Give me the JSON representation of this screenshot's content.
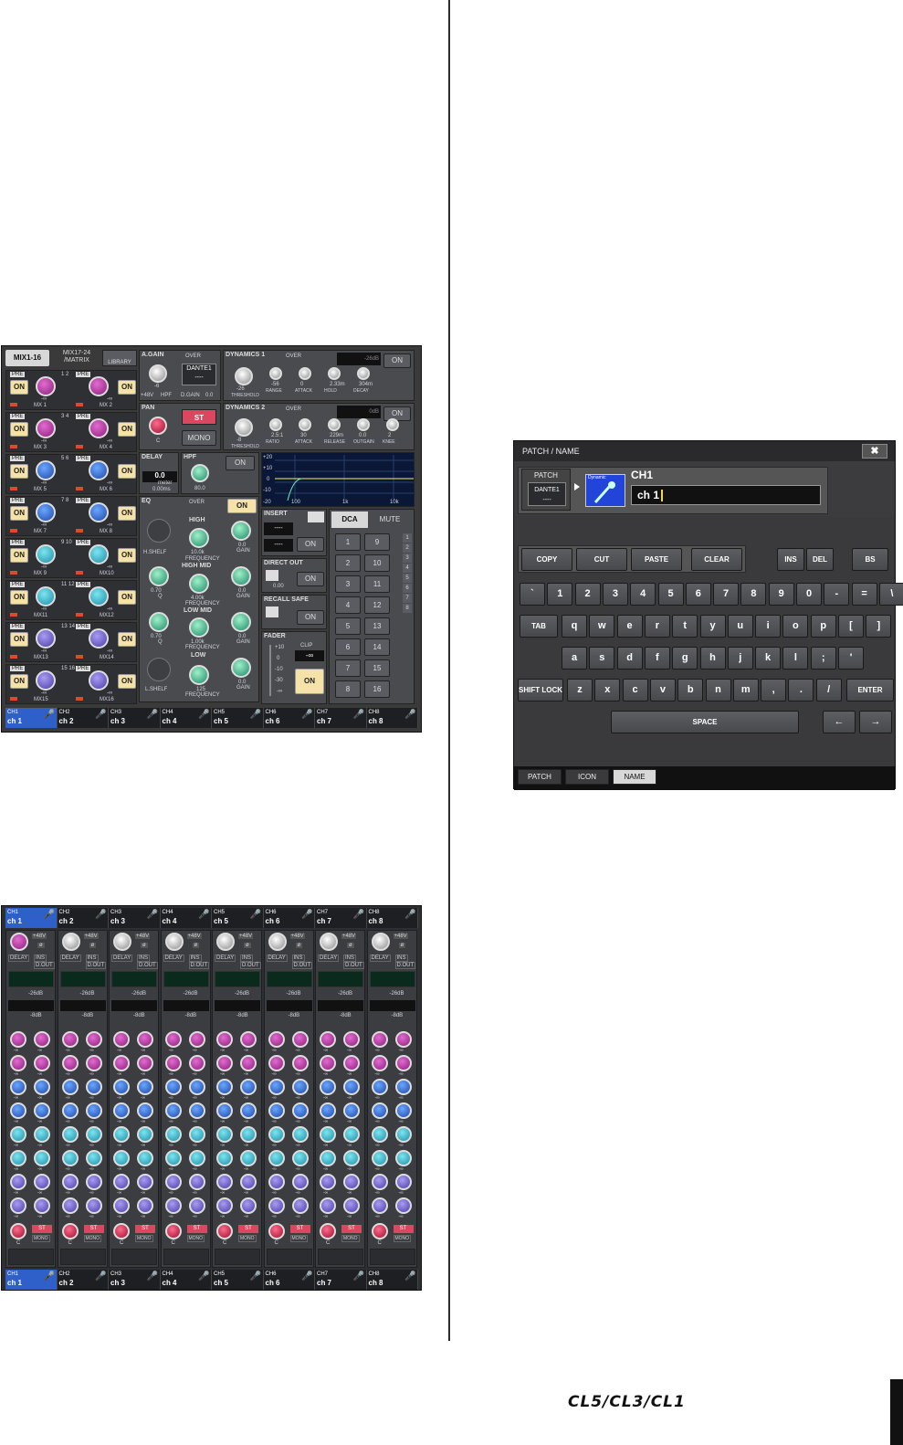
{
  "product_logo": "CL5/CL3/CL1",
  "colors": {
    "accent_blue": "#2f5fc9",
    "on_button": "#f4e2a8",
    "panel": "#3a3a3a"
  },
  "screenshot1": {
    "tabs": [
      "MIX1-16",
      "MIX17-24 /MATRIX",
      "LIBRARY"
    ],
    "mix_labels": [
      "MX 1",
      "MX 2",
      "MX 3",
      "MX 4",
      "MX 5",
      "MX 6",
      "MX 7",
      "MX 8",
      "MX 9",
      "MX10",
      "MX11",
      "MX12",
      "MX13",
      "MX14",
      "MX15",
      "MX16"
    ],
    "pair_numbers": [
      "1 2",
      "3 4",
      "5 6",
      "7 8",
      "9 10",
      "11 12",
      "13 14",
      "15 16"
    ],
    "pre_label": "PRE",
    "on_label": "ON",
    "minus_inf": "-∞",
    "again": {
      "title": "A.GAIN",
      "over": "OVER",
      "patch": "DANTE1",
      "dash": "----",
      "gain": "-6",
      "plus48": "+48V",
      "hpf": "HPF",
      "dgain": "D.GAIN",
      "dval": "0.0"
    },
    "pan": {
      "title": "PAN",
      "st": "ST",
      "mono": "MONO",
      "val": "C"
    },
    "delay": {
      "title": "DELAY",
      "val": "0.0",
      "unit": "meter",
      "ms": "0.00ms"
    },
    "hpf": {
      "title": "HPF",
      "val": "80.0",
      "on": "ON"
    },
    "dyn1": {
      "title": "DYNAMICS 1",
      "over": "OVER",
      "db": "-26dB",
      "on": "ON",
      "values": [
        "-26",
        "-56",
        "0",
        "2.33m",
        "304m"
      ],
      "labels": [
        "THRESHOLD",
        "RANGE",
        "ATTACK",
        "HOLD",
        "DECAY"
      ]
    },
    "dyn2": {
      "title": "DYNAMICS 2",
      "over": "OVER",
      "db": "0dB",
      "on": "ON",
      "values": [
        "-8",
        "2.5:1",
        "30",
        "229m",
        "0.0",
        "2"
      ],
      "labels": [
        "THRESHOLD",
        "RATIO",
        "ATTACK",
        "RELEASE",
        "OUTGAIN",
        "KNEE"
      ]
    },
    "graph_y": [
      "+20",
      "+10",
      "0",
      "-10",
      "-20"
    ],
    "graph_x": [
      "100",
      "1k",
      "10k"
    ],
    "eq": {
      "title": "EQ",
      "over": "OVER",
      "on": "ON",
      "high": "HIGH",
      "highmid": "HIGH MID",
      "lowmid": "LOW MID",
      "low": "LOW",
      "hshelf": "H.SHELF",
      "lshelf": "L.SHELF",
      "freqs": [
        "10.0k",
        "4.00k",
        "1.00k",
        "125"
      ],
      "qs": [
        "0.70",
        "0.70"
      ],
      "gains": [
        "0.0",
        "0.0",
        "0.0",
        "0.0"
      ],
      "frequency": "FREQUENCY",
      "gain": "GAIN",
      "q": "Q"
    },
    "insert": {
      "title": "INSERT",
      "dash": "----",
      "on": "ON"
    },
    "directout": {
      "title": "DIRECT OUT",
      "val": "0.00",
      "on": "ON"
    },
    "recallsafe": {
      "title": "RECALL SAFE",
      "on": "ON"
    },
    "fader": {
      "title": "FADER",
      "clip": "CLIP",
      "val": "-∞",
      "on": "ON",
      "scale": [
        "+10",
        "0",
        "-10",
        "-30",
        "-∞"
      ]
    },
    "dca_tabs": [
      "DCA",
      "MUTE"
    ],
    "dca_numbers": [
      "1",
      "9",
      "2",
      "10",
      "3",
      "11",
      "4",
      "12",
      "5",
      "13",
      "6",
      "14",
      "7",
      "15",
      "8",
      "16"
    ],
    "side_numbers": [
      "1",
      "2",
      "3",
      "4",
      "5",
      "6",
      "7",
      "8"
    ],
    "channels": [
      {
        "ch": "CH1",
        "name": "ch 1"
      },
      {
        "ch": "CH2",
        "name": "ch 2"
      },
      {
        "ch": "CH3",
        "name": "ch 3"
      },
      {
        "ch": "CH4",
        "name": "ch 4"
      },
      {
        "ch": "CH5",
        "name": "ch 5"
      },
      {
        "ch": "CH6",
        "name": "ch 6"
      },
      {
        "ch": "CH7",
        "name": "ch 7"
      },
      {
        "ch": "CH8",
        "name": "ch 8"
      }
    ]
  },
  "screenshot2": {
    "channels": [
      {
        "ch": "CH1",
        "name": "ch 1"
      },
      {
        "ch": "CH2",
        "name": "ch 2"
      },
      {
        "ch": "CH3",
        "name": "ch 3"
      },
      {
        "ch": "CH4",
        "name": "ch 4"
      },
      {
        "ch": "CH5",
        "name": "ch 5"
      },
      {
        "ch": "CH6",
        "name": "ch 6"
      },
      {
        "ch": "CH7",
        "name": "ch 7"
      },
      {
        "ch": "CH8",
        "name": "ch 8"
      }
    ],
    "plus48": "+48V",
    "phase": "ø",
    "delay": "DELAY",
    "ins": "INS",
    "dout": "D.OUT",
    "db1": "-26dB",
    "db2": "-8dB",
    "minus_inf": "-∞",
    "st": "ST",
    "mono": "MONO",
    "pan": "C"
  },
  "patch_dialog": {
    "title": "PATCH / NAME",
    "close": "✖",
    "patch_label": "PATCH",
    "patch_value": "DANTE1",
    "patch_dash": "----",
    "icon_label": "Dynamic",
    "channel": "CH1",
    "name_value": "ch 1",
    "edit_buttons": [
      "COPY",
      "CUT",
      "PASTE",
      "CLEAR"
    ],
    "ins": "INS",
    "del": "DEL",
    "bs": "BS",
    "row1": [
      "`",
      "1",
      "2",
      "3",
      "4",
      "5",
      "6",
      "7",
      "8",
      "9",
      "0",
      "-",
      "=",
      "\\"
    ],
    "row2_tab": "TAB",
    "row2": [
      "q",
      "w",
      "e",
      "r",
      "t",
      "y",
      "u",
      "i",
      "o",
      "p",
      "[",
      "]"
    ],
    "row3": [
      "a",
      "s",
      "d",
      "f",
      "g",
      "h",
      "j",
      "k",
      "l",
      ";",
      "'"
    ],
    "shift_lock": "SHIFT LOCK",
    "row4": [
      "z",
      "x",
      "c",
      "v",
      "b",
      "n",
      "m",
      ",",
      ".",
      "/"
    ],
    "enter": "ENTER",
    "space": "SPACE",
    "left": "←",
    "right": "→",
    "tabs": [
      "PATCH",
      "ICON",
      "NAME"
    ]
  }
}
